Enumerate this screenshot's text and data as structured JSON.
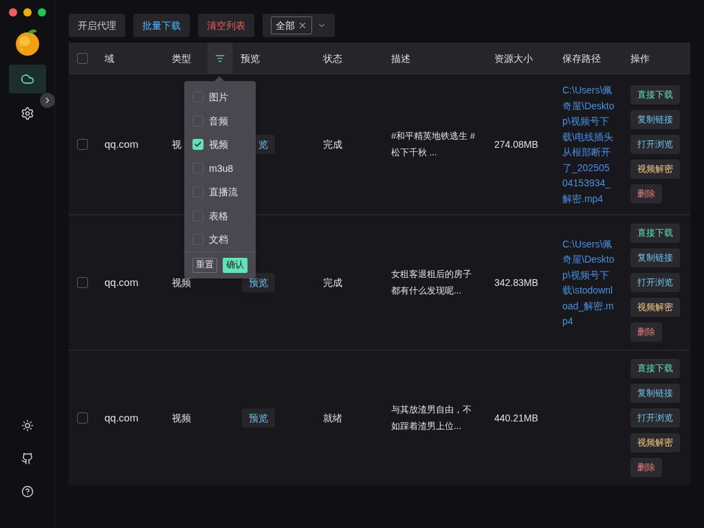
{
  "sidebar": {
    "nav": [
      {
        "kind": "cloud",
        "selected": true
      },
      {
        "kind": "settings",
        "selected": false
      }
    ],
    "bottom": [
      {
        "kind": "theme"
      },
      {
        "kind": "github"
      },
      {
        "kind": "help"
      }
    ]
  },
  "toolbar": {
    "buttons": [
      {
        "label": "开启代理",
        "kind": "default"
      },
      {
        "label": "批量下载",
        "kind": "primary"
      },
      {
        "label": "清空列表",
        "kind": "danger"
      }
    ],
    "filter_select": {
      "tag": "全部"
    }
  },
  "table": {
    "select_all": {
      "checked": false
    },
    "columns": [
      "域",
      "类型",
      "预览",
      "状态",
      "描述",
      "资源大小",
      "保存路径",
      "操作"
    ],
    "rows": [
      {
        "checked": false,
        "domain": "qq.com",
        "type": "视",
        "preview": "览",
        "status": "完成",
        "description": "#和平精英地铁逃生 #松下千秋 ...",
        "size": "274.08MB",
        "path": "C:\\Users\\佩奇屋\\Desktop\\视频号下载\\电线插头从根部断开了_20250504153934_解密.mp4",
        "actions": [
          {
            "label": "直接下载",
            "kind": "download"
          },
          {
            "label": "复制链接",
            "kind": "copy"
          },
          {
            "label": "打开浏览",
            "kind": "open"
          },
          {
            "label": "视频解密",
            "kind": "decrypt"
          },
          {
            "label": "删除",
            "kind": "delete"
          }
        ]
      },
      {
        "checked": false,
        "domain": "qq.com",
        "type": "视频",
        "preview": "预览",
        "status": "完成",
        "description": "女租客退租后的房子都有什么发现呢...",
        "size": "342.83MB",
        "path": "C:\\Users\\佩奇屋\\Desktop\\视频号下载\\stodownload_解密.mp4",
        "actions": [
          {
            "label": "直接下载",
            "kind": "download"
          },
          {
            "label": "复制链接",
            "kind": "copy"
          },
          {
            "label": "打开浏览",
            "kind": "open"
          },
          {
            "label": "视频解密",
            "kind": "decrypt"
          },
          {
            "label": "删除",
            "kind": "delete"
          }
        ]
      },
      {
        "checked": false,
        "domain": "qq.com",
        "type": "视频",
        "preview": "预览",
        "status": "就绪",
        "description": "与其放渣男自由，不如踩着渣男上位...",
        "size": "440.21MB",
        "actions": [
          {
            "label": "直接下载",
            "kind": "download"
          },
          {
            "label": "复制链接",
            "kind": "copy"
          },
          {
            "label": "打开浏览",
            "kind": "open"
          },
          {
            "label": "视频解密",
            "kind": "decrypt"
          },
          {
            "label": "删除",
            "kind": "delete"
          }
        ]
      }
    ]
  },
  "type_filter": {
    "options": [
      {
        "label": "图片",
        "checked": false
      },
      {
        "label": "音频",
        "checked": false
      },
      {
        "label": "视频",
        "checked": true
      },
      {
        "label": "m3u8",
        "checked": false
      },
      {
        "label": "直播流",
        "checked": false
      },
      {
        "label": "表格",
        "checked": false
      },
      {
        "label": "文档",
        "checked": false
      }
    ],
    "reset": "重置",
    "confirm": "确认"
  }
}
